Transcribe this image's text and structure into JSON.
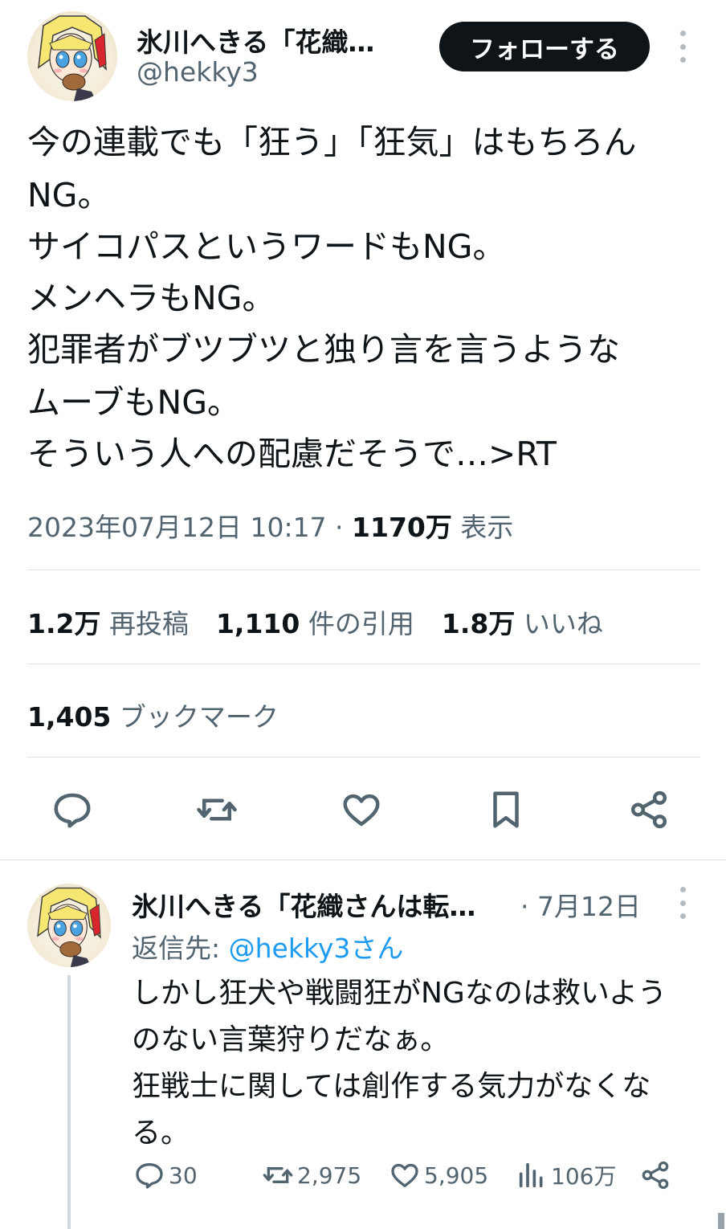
{
  "main_tweet": {
    "author": {
      "display_name": "氷川へきる「花織…",
      "handle": "@hekky3",
      "avatar_icon": "anime-avatar-icon"
    },
    "follow_label": "フォローする",
    "text_lines": [
      "今の連載でも「狂う」「狂気」はもちろん",
      "NG。",
      "サイコパスというワードもNG。",
      "メンヘラもNG。",
      "犯罪者がブツブツと独り言を言うような",
      "ムーブもNG。",
      "そういう人への配慮だそうで…>RT"
    ],
    "meta": {
      "timestamp": "2023年07月12日 10:17",
      "separator": " · ",
      "views_value": "1170万",
      "views_label": " 表示"
    },
    "stats": {
      "reposts_value": "1.2万",
      "reposts_label": " 再投稿",
      "quotes_value": "1,110",
      "quotes_label": " 件の引用",
      "likes_value": "1.8万",
      "likes_label": " いいね",
      "bookmarks_value": "1,405",
      "bookmarks_label": " ブックマーク"
    },
    "actions": [
      "reply-icon",
      "repost-icon",
      "like-icon",
      "bookmark-icon",
      "share-icon"
    ]
  },
  "reply": {
    "author": {
      "display_name": "氷川へきる「花織さんは転…",
      "date": "· 7月12日",
      "avatar_icon": "anime-avatar-icon"
    },
    "reply_to_label": "返信先: ",
    "reply_to_handle": "@hekky3さん",
    "text_lines": [
      "しかし狂犬や戦闘狂がNGなのは救いよう",
      "のない言葉狩りだなぁ。",
      "狂戦士に関しては創作する気力がなくな",
      "る。"
    ],
    "actions": {
      "replies": "30",
      "reposts": "2,975",
      "likes": "5,905",
      "views": "106万"
    }
  },
  "colors": {
    "text_primary": "#0f1419",
    "text_secondary": "#536471",
    "link": "#1d9bf0",
    "divider": "#dfe3e6",
    "button_bg": "#0f1419"
  }
}
